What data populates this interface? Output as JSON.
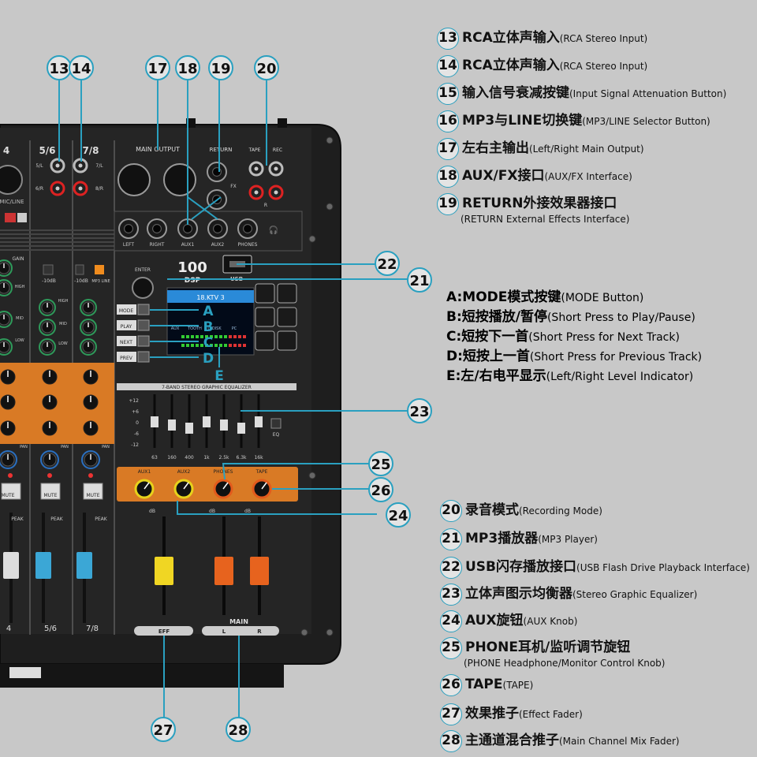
{
  "callouts_top": [
    {
      "num": "13",
      "cn": "RCA立体声输入",
      "en": "(RCA Stereo Input)"
    },
    {
      "num": "14",
      "cn": "RCA立体声输入",
      "en": "(RCA Stereo Input)"
    },
    {
      "num": "15",
      "cn": "输入信号衰减按键",
      "en": "(Input Signal Attenuation Button)"
    },
    {
      "num": "16",
      "cn": "MP3与LINE切换键",
      "en": "(MP3/LINE Selector Button)"
    },
    {
      "num": "17",
      "cn": "左右主输出",
      "en": "(Left/Right Main Output)"
    },
    {
      "num": "18",
      "cn": "AUX/FX接口",
      "en": "(AUX/FX Interface)"
    },
    {
      "num": "19",
      "cn": "RETURN外接效果器接口",
      "en": "",
      "sub": "(RETURN External Effects Interface)"
    }
  ],
  "abc": [
    {
      "key": "A:MODE模式按键",
      "en": "(MODE Button)"
    },
    {
      "key": "B:短按播放/暂停",
      "en": "(Short Press to Play/Pause)"
    },
    {
      "key": "C:短按下一首",
      "en": "(Short Press for Next Track)"
    },
    {
      "key": "D:短按上一首",
      "en": "(Short Press for Previous Track)"
    },
    {
      "key": "E:左/右电平显示",
      "en": "(Left/Right Level Indicator)"
    }
  ],
  "callouts_bottom": [
    {
      "num": "20",
      "cn": "录音模式",
      "en": "(Recording Mode)"
    },
    {
      "num": "21",
      "cn": "MP3播放器",
      "en": "(MP3 Player)"
    },
    {
      "num": "22",
      "cn": "USB闪存播放接口",
      "en": "(USB Flash Drive Playback Interface)"
    },
    {
      "num": "23",
      "cn": "立体声图示均衡器",
      "en": "(Stereo Graphic Equalizer)"
    },
    {
      "num": "24",
      "cn": "AUX旋钮",
      "en": "(AUX Knob)"
    },
    {
      "num": "25",
      "cn": "PHONE耳机/监听调节旋钮",
      "en": "",
      "sub": "(PHONE Headphone/Monitor Control Knob)"
    },
    {
      "num": "26",
      "cn": "TAPE",
      "en": "(TAPE)"
    },
    {
      "num": "27",
      "cn": "效果推子",
      "en": "(Effect Fader)"
    },
    {
      "num": "28",
      "cn": "主通道混合推子",
      "en": "(Main Channel Mix Fader)"
    }
  ],
  "diagram_numbers": [
    "13",
    "14",
    "17",
    "18",
    "19",
    "20",
    "22",
    "21",
    "23",
    "25",
    "26",
    "24",
    "27",
    "28"
  ],
  "diagram_letters": [
    "A",
    "B",
    "C",
    "D",
    "E"
  ],
  "panel": {
    "brand": "100",
    "brand_sub": "DSP",
    "usb": "USB",
    "enter": "ENTER",
    "ch_labels": [
      "4",
      "5/6",
      "7/8"
    ],
    "main_output": "MAIN OUTPUT",
    "return_label": "RETURN",
    "fx_label": "FX",
    "tape_label": "TAPE",
    "rec_label": "REC",
    "rca_l": "5/L",
    "rca_r": "6/R",
    "rca_l2": "7/L",
    "rca_r2": "8/R",
    "r_label": "R",
    "jack_labels": [
      "LEFT",
      "RIGHT",
      "AUX1",
      "AUX2",
      "PHONES"
    ],
    "minus10": "-10dB",
    "mp3_line": "MP3 LINE",
    "mode_btns": [
      "MODE",
      "PLAY",
      "NEXT",
      "PREV"
    ],
    "screen_title": "18.KTV 3",
    "screen_items": [
      "AUX",
      "TOOTH",
      "U-DISK",
      "PC"
    ],
    "eq_title": "7-BAND STEREO GRAPHIC EQUALIZER",
    "eq_scale": [
      "+12",
      "+6",
      "0",
      "-6",
      "-12"
    ],
    "eq_freqs": [
      "63",
      "160",
      "400",
      "1k",
      "2.5k",
      "6.3k",
      "16k"
    ],
    "eq_btn": "EQ",
    "knob_labels": [
      "AUX1",
      "AUX2",
      "PHONES",
      "TAPE"
    ],
    "knob_range": [
      "00",
      "+15"
    ],
    "mute": "MUTE",
    "peak": "PEAK",
    "eff": "EFF",
    "main": "MAIN",
    "l": "L",
    "r": "R",
    "db": "dB",
    "gain": "GAIN",
    "high": "HIGH",
    "mid": "MID",
    "low": "LOW",
    "pan": "PAN",
    "mic_line": "MIC/LINE"
  }
}
